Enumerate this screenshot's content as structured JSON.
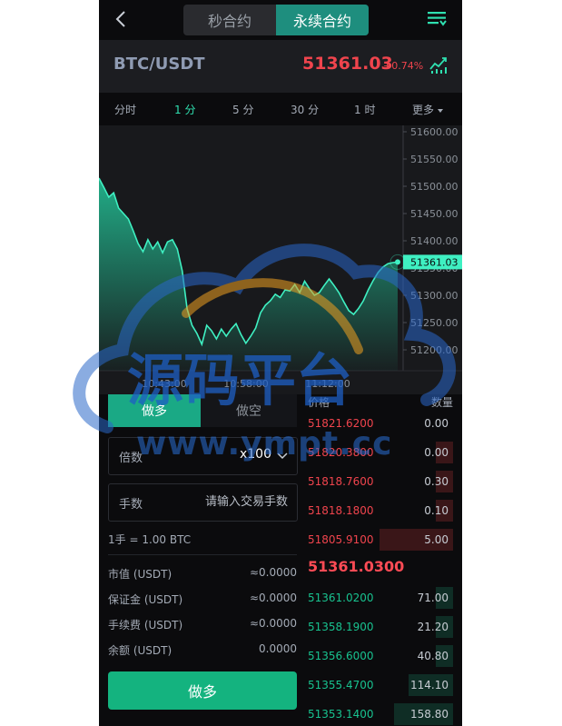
{
  "header": {
    "tabs": [
      "秒合约",
      "永续合约"
    ],
    "active_tab": 1
  },
  "symbol": {
    "pair": "BTC/USDT",
    "price": "51361.03",
    "change": "+0.74%"
  },
  "intervals": [
    {
      "label": "分时",
      "active": false
    },
    {
      "label": "1 分",
      "active": true
    },
    {
      "label": "5 分",
      "active": false
    },
    {
      "label": "30 分",
      "active": false
    },
    {
      "label": "1 时",
      "active": false
    },
    {
      "label": "更多",
      "active": false
    }
  ],
  "chart_data": {
    "type": "area",
    "y_ticks": [
      "51600.00",
      "51550.00",
      "51500.00",
      "51450.00",
      "51400.00",
      "51350.00",
      "51300.00",
      "51250.00",
      "51200.00"
    ],
    "ylim": [
      51175,
      51625
    ],
    "x_ticks": [
      "10:43:00",
      "10:58:00",
      "11:12:00"
    ],
    "last_price_label": "51361.03",
    "values": [
      51515,
      51498,
      51480,
      51488,
      51460,
      51450,
      51440,
      51418,
      51395,
      51380,
      51402,
      51385,
      51398,
      51378,
      51398,
      51402,
      51385,
      51345,
      51275,
      51245,
      51230,
      51210,
      51245,
      51235,
      51220,
      51238,
      51225,
      51238,
      51248,
      51228,
      51212,
      51225,
      51240,
      51268,
      51282,
      51290,
      51302,
      51296,
      51310,
      51308,
      51320,
      51305,
      51326,
      51312,
      51300,
      51305,
      51318,
      51330,
      51318,
      51305,
      51288,
      51272,
      51265,
      51276,
      51290,
      51310,
      51327,
      51342,
      51352,
      51358,
      51360,
      51361
    ]
  },
  "form": {
    "long_label": "做多",
    "short_label": "做空",
    "leverage_label": "倍数",
    "leverage_value": "x100",
    "qty_label": "手数",
    "qty_placeholder": "请输入交易手数",
    "unit_note": "1手 = 1.00 BTC",
    "rows": [
      {
        "label": "市值 (USDT)",
        "value": "≈0.0000"
      },
      {
        "label": "保证金 (USDT)",
        "value": "≈0.0000"
      },
      {
        "label": "手续费 (USDT)",
        "value": "≈0.0000"
      },
      {
        "label": "余额 (USDT)",
        "value": "0.0000"
      }
    ],
    "submit_label": "做多"
  },
  "book": {
    "price_header": "价格",
    "qty_header": "数量",
    "asks": [
      {
        "price": "51821.6200",
        "qty": "0.00",
        "depth": 0
      },
      {
        "price": "51820.3800",
        "qty": "0.00",
        "depth": 0.12
      },
      {
        "price": "51818.7600",
        "qty": "0.30",
        "depth": 0.12
      },
      {
        "price": "51818.1800",
        "qty": "0.10",
        "depth": 0.12
      },
      {
        "price": "51805.9100",
        "qty": "5.00",
        "depth": 0.5
      }
    ],
    "mid_price": "51361.0300",
    "bids": [
      {
        "price": "51361.0200",
        "qty": "71.00",
        "depth": 0.12
      },
      {
        "price": "51358.1900",
        "qty": "21.20",
        "depth": 0.12
      },
      {
        "price": "51356.6000",
        "qty": "40.80",
        "depth": 0.12
      },
      {
        "price": "51355.4700",
        "qty": "114.10",
        "depth": 0.3
      },
      {
        "price": "51353.1400",
        "qty": "158.80",
        "depth": 0.4
      }
    ]
  },
  "watermark": {
    "title": "源码平台",
    "url": "www.ympt.cc"
  },
  "colors": {
    "accent": "#1aa985",
    "up": "#18c28f",
    "down": "#f0444d"
  }
}
